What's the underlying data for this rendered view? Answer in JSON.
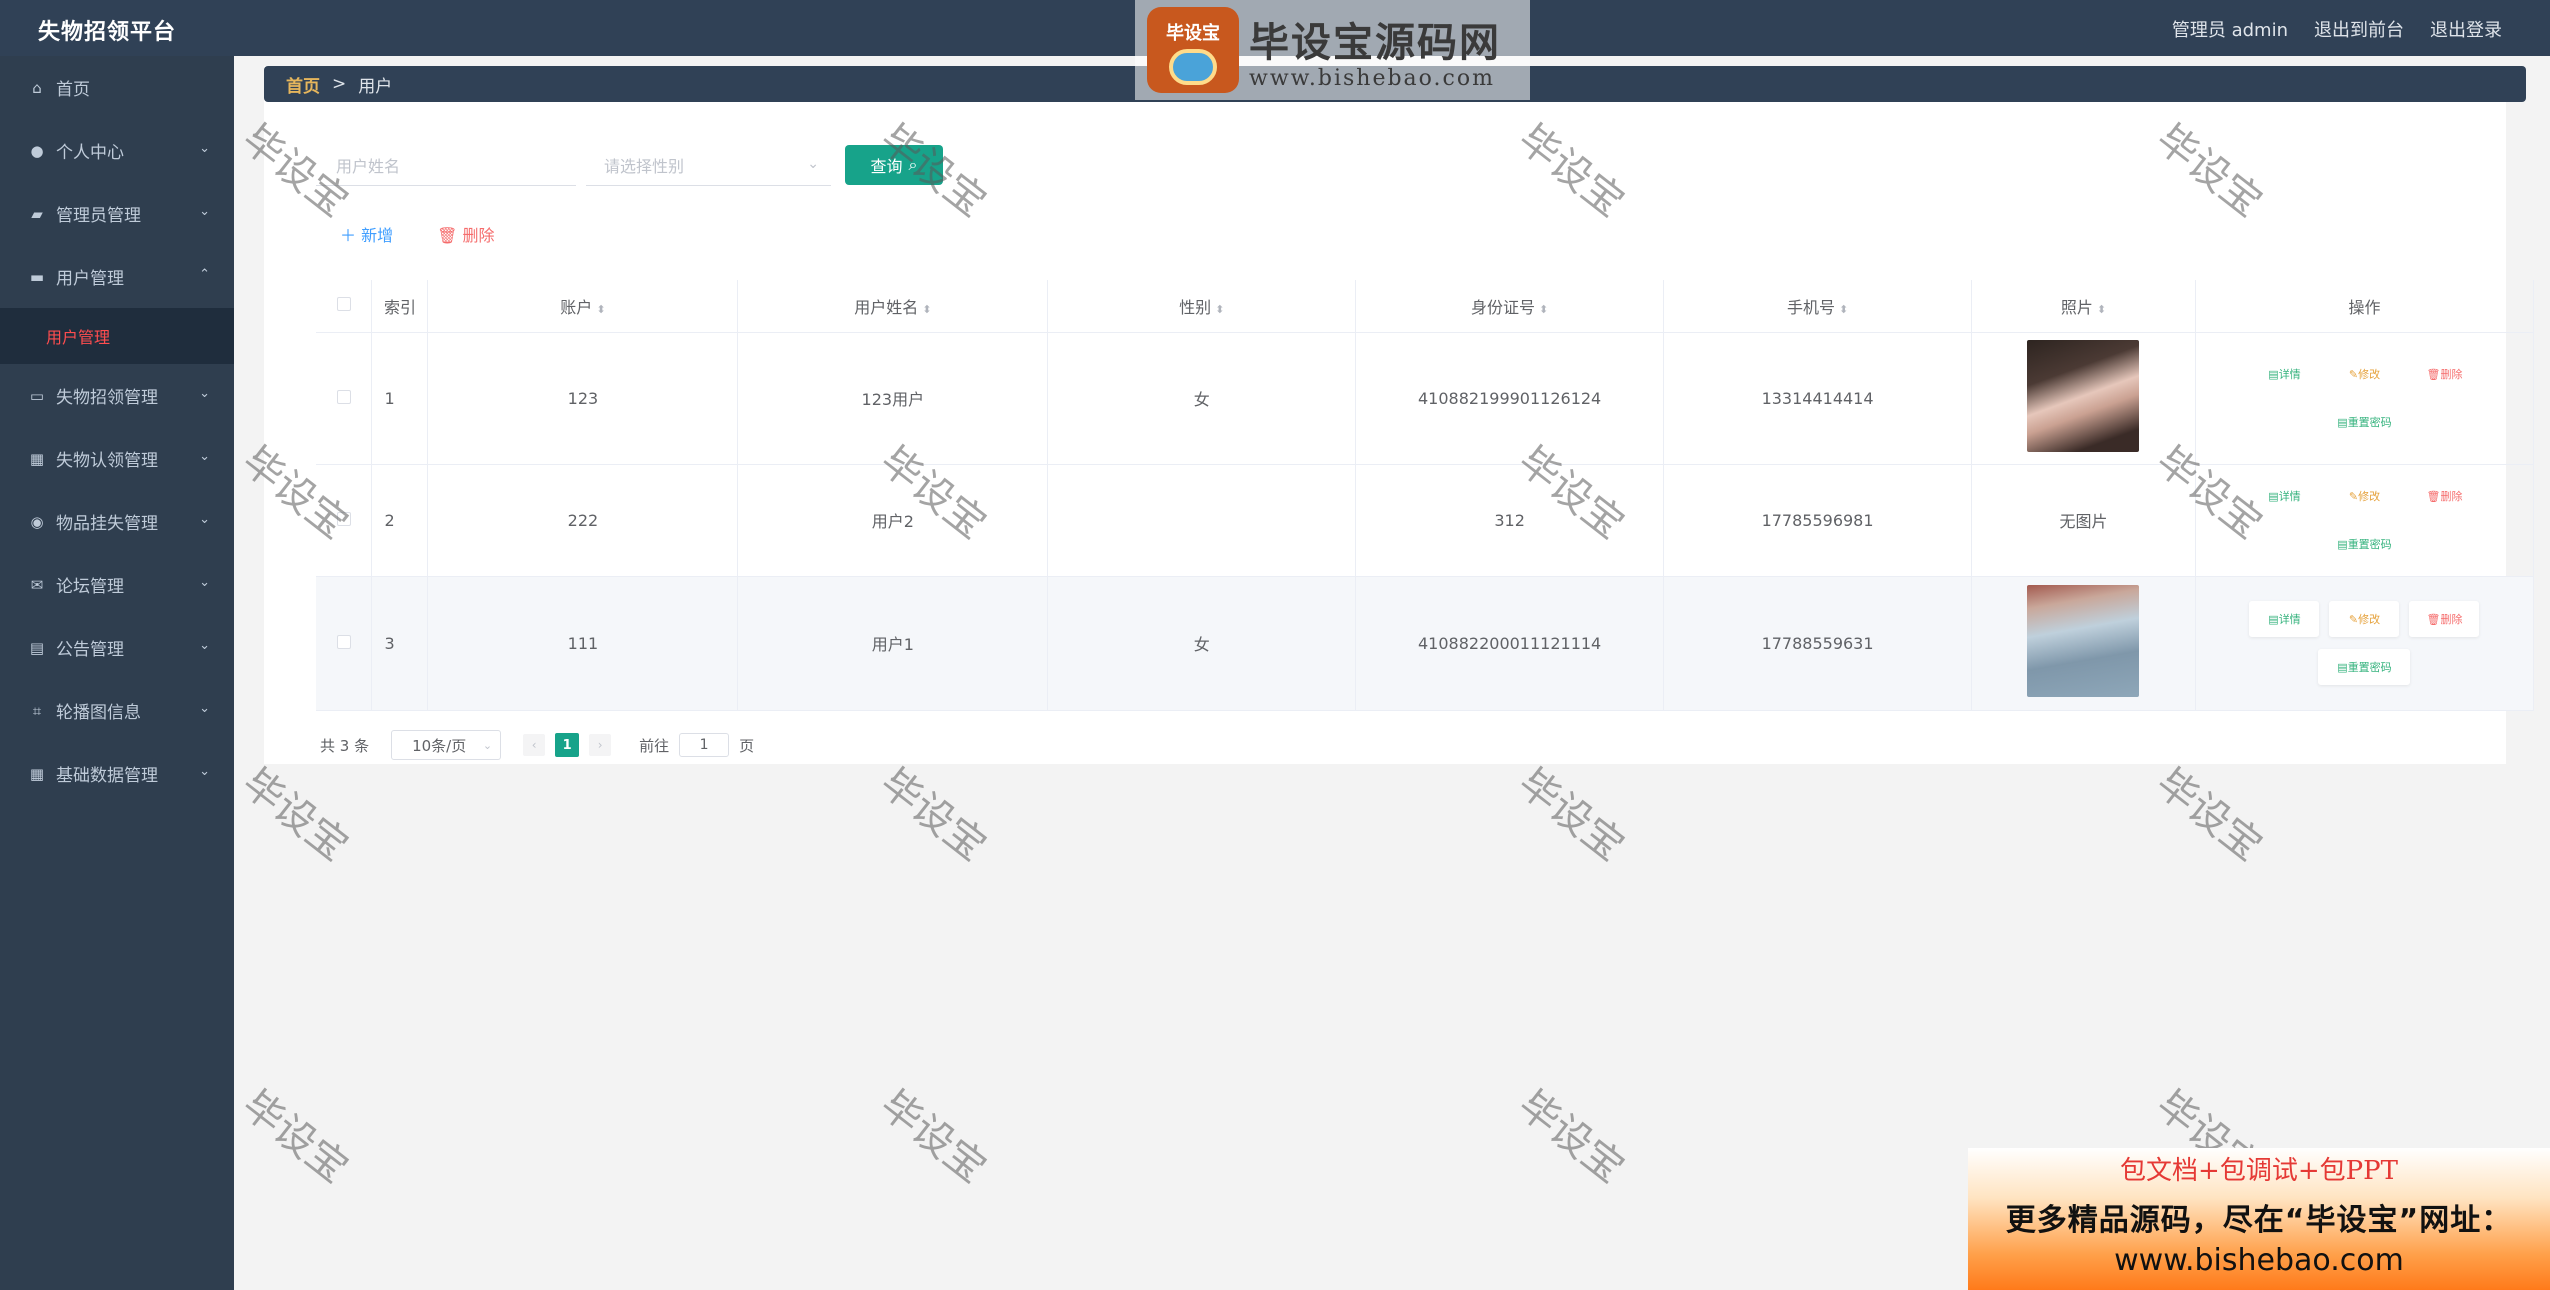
{
  "app": {
    "title": "失物招领平台",
    "top_links": [
      "管理员 admin",
      "退出到前台",
      "退出登录"
    ]
  },
  "watermark": {
    "logo_badge": "毕设宝",
    "logo_title": "毕设宝源码网",
    "logo_url": "www.bishebao.com",
    "repeat_text": "毕设宝",
    "ad_line1": "包文档+包调试+包PPT",
    "ad_line2": "更多精品源码，尽在“毕设宝”网址：",
    "ad_line3": "www.bishebao.com"
  },
  "sidebar": {
    "items": [
      {
        "label": "首页",
        "icon": "home-icon",
        "has_chevron": false
      },
      {
        "label": "个人中心",
        "icon": "user-icon",
        "has_chevron": true
      },
      {
        "label": "管理员管理",
        "icon": "chat-icon",
        "has_chevron": true
      },
      {
        "label": "用户管理",
        "icon": "briefcase-icon",
        "has_chevron": true,
        "expanded": true
      },
      {
        "label": "失物招领管理",
        "icon": "id-card-icon",
        "has_chevron": true
      },
      {
        "label": "失物认领管理",
        "icon": "grid-icon",
        "has_chevron": true
      },
      {
        "label": "物品挂失管理",
        "icon": "compass-icon",
        "has_chevron": true
      },
      {
        "label": "论坛管理",
        "icon": "mail-icon",
        "has_chevron": true
      },
      {
        "label": "公告管理",
        "icon": "clipboard-icon",
        "has_chevron": true
      },
      {
        "label": "轮播图信息",
        "icon": "crop-icon",
        "has_chevron": true
      },
      {
        "label": "基础数据管理",
        "icon": "apps-icon",
        "has_chevron": true
      }
    ],
    "active_sub": "用户管理"
  },
  "breadcrumb": {
    "home": "首页",
    "sep": ">",
    "current": "用户"
  },
  "search": {
    "name_placeholder": "用户姓名",
    "gender_placeholder": "请选择性别",
    "query_label": "查询"
  },
  "actions": {
    "add_label": "新增",
    "delete_label": "删除"
  },
  "table": {
    "headers": [
      "索引",
      "账户",
      "用户姓名",
      "性别",
      "身份证号",
      "手机号",
      "照片",
      "操作"
    ],
    "rows": [
      {
        "index": "1",
        "account": "123",
        "name": "123用户",
        "gender": "女",
        "id_card": "410882199901126124",
        "phone": "13314414414",
        "photo": "image"
      },
      {
        "index": "2",
        "account": "222",
        "name": "用户2",
        "gender": "",
        "id_card": "312",
        "phone": "17785596981",
        "photo": "无图片"
      },
      {
        "index": "3",
        "account": "111",
        "name": "用户1",
        "gender": "女",
        "id_card": "410882200011121114",
        "phone": "17788559631",
        "photo": "image"
      }
    ],
    "ops": {
      "detail": "详情",
      "edit": "修改",
      "delete": "删除",
      "reset": "重置密码"
    }
  },
  "pagination": {
    "total": "共 3 条",
    "page_size": "10条/页",
    "current": "1",
    "goto_label": "前往",
    "goto_value": "1",
    "page_suffix": "页"
  }
}
